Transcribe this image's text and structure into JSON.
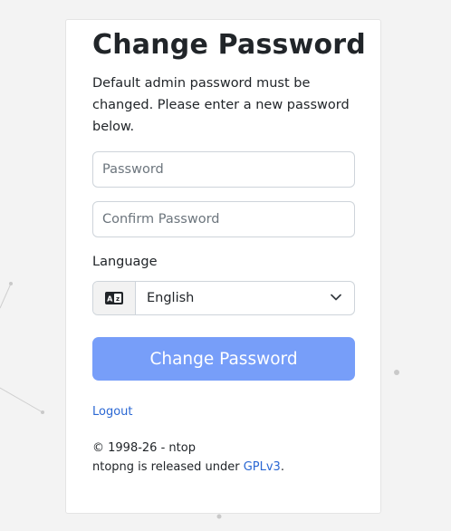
{
  "page": {
    "title": "Change Password",
    "description": "Default admin password must be changed. Please enter a new password below."
  },
  "form": {
    "password_placeholder": "Password",
    "confirm_placeholder": "Confirm Password",
    "language_label": "Language",
    "language_selected": "English",
    "submit_label": "Change Password"
  },
  "links": {
    "logout": "Logout"
  },
  "footer": {
    "copyright": "© 1998-26 - ntop",
    "license_prefix": "ntopng is released under",
    "license_link": "GPLv3",
    "license_suffix": "."
  },
  "icons": {
    "language": "language-icon",
    "dropdown": "chevron-down-icon"
  },
  "colors": {
    "primary_button": "#779ef9",
    "link": "#2a67d3",
    "background": "#f3f3f3"
  }
}
